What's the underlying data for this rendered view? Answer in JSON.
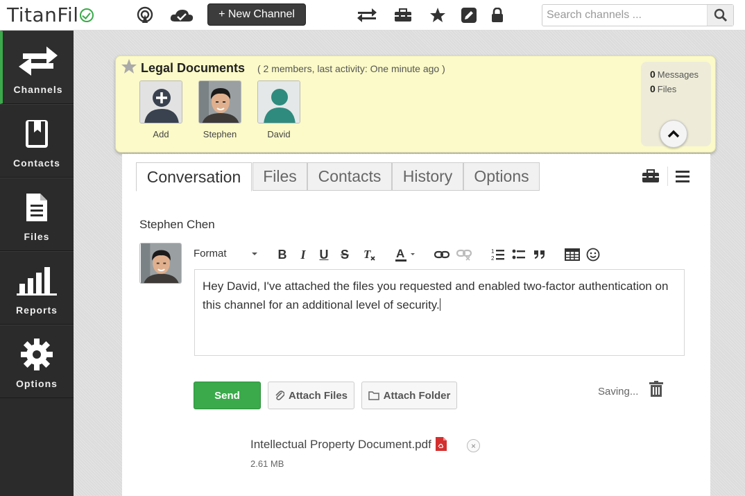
{
  "header": {
    "logo_text": "TitanFil",
    "new_channel_label": "+ New Channel",
    "search_placeholder": "Search channels ...",
    "icons": [
      "broadcast-icon",
      "cloud-sync-icon",
      "transfer-icon",
      "toolbox-icon",
      "star-icon",
      "edit-icon",
      "lock-icon",
      "search-icon"
    ]
  },
  "sidebar": {
    "items": [
      {
        "label": "Channels",
        "icon": "arrows-exchange-icon",
        "active": true
      },
      {
        "label": "Contacts",
        "icon": "address-book-icon",
        "active": false
      },
      {
        "label": "Files",
        "icon": "file-icon",
        "active": false
      },
      {
        "label": "Reports",
        "icon": "bar-chart-icon",
        "active": false
      },
      {
        "label": "Options",
        "icon": "gear-icon",
        "active": false
      }
    ]
  },
  "channel": {
    "title": "Legal Documents",
    "meta": "( 2 members, last activity: One minute ago )",
    "members": [
      {
        "name": "Add"
      },
      {
        "name": "Stephen"
      },
      {
        "name": "David"
      }
    ],
    "stats": {
      "messages_count": "0",
      "messages_label": "Messages",
      "files_count": "0",
      "files_label": "Files"
    }
  },
  "tabs": [
    {
      "label": "Conversation",
      "active": true
    },
    {
      "label": "Files",
      "active": false
    },
    {
      "label": "Contacts",
      "active": false
    },
    {
      "label": "History",
      "active": false
    },
    {
      "label": "Options",
      "active": false
    }
  ],
  "composer": {
    "author": "Stephen Chen",
    "format_label": "Format",
    "message": "Hey David, I've attached the files you requested and enabled two-factor authentication on this channel for an additional level of security.",
    "send_label": "Send",
    "attach_files_label": "Attach Files",
    "attach_folder_label": "Attach Folder",
    "saving_text": "Saving..."
  },
  "attachment": {
    "name": "Intellectual Property Document.pdf",
    "size": "2.61 MB",
    "remove_label": "×"
  },
  "colors": {
    "accent_green": "#3aaa4a",
    "sidebar_bg": "#2b2b2b",
    "card_bg": "#fbfac8",
    "pdf_red": "#d32f2f"
  }
}
